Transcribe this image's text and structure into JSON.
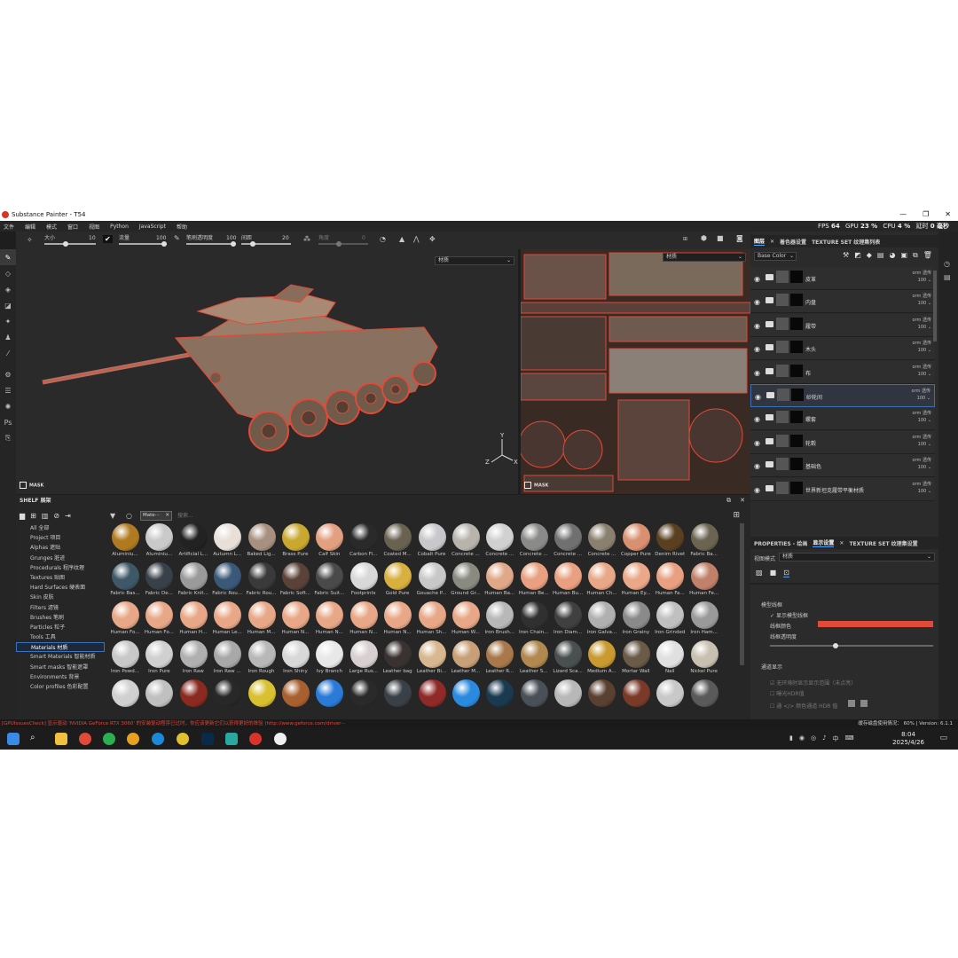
{
  "window": {
    "title": "Substance Painter - T54",
    "min": "—",
    "max": "❐",
    "close": "✕"
  },
  "menu": [
    "文件",
    "编辑",
    "模式",
    "窗口",
    "视图",
    "Python",
    "JavaScript",
    "帮助"
  ],
  "perf": {
    "fps_label": "FPS",
    "fps": "64",
    "gpu_label": "GPU",
    "gpu": "23 %",
    "cpu_label": "CPU",
    "cpu": "4 %",
    "delay_label": "延时",
    "delay": "0 毫秒"
  },
  "tool_options": {
    "size_label": "大小",
    "size": "10",
    "size_level": 0.4,
    "flow_label": "流量",
    "flow": "100",
    "flow_level": 1.0,
    "opacity_label": "笔刷透明度",
    "opacity": "100",
    "opacity_level": 1.0,
    "spacing_label": "间距",
    "spacing": "20",
    "spacing_level": 0.2,
    "angle_label": "角度",
    "angle": "0"
  },
  "viewport3d": {
    "mode_select": "材质",
    "mask_label": "MASK"
  },
  "viewport2d": {
    "mode_select": "材质",
    "mask_label": "MASK"
  },
  "right_tabs": {
    "layers": "图层",
    "color_settings": "着色器设置",
    "texture_set": "TEXTURE SET 纹理集列表"
  },
  "channel_select": "Base Color",
  "layers": [
    {
      "name": "皮革",
      "blend": "orm 透传",
      "opacity": "100"
    },
    {
      "name": "内盘",
      "blend": "orm 透传",
      "opacity": "100"
    },
    {
      "name": "履带",
      "blend": "orm 透传",
      "opacity": "100"
    },
    {
      "name": "木头",
      "blend": "orm 透传",
      "opacity": "100"
    },
    {
      "name": "布",
      "blend": "orm 透传",
      "opacity": "100"
    },
    {
      "name": "砂轮间",
      "blend": "orm 透传",
      "opacity": "100"
    },
    {
      "name": "螺套",
      "blend": "orm 透传",
      "opacity": "100"
    },
    {
      "name": "轮毂",
      "blend": "orm 透传",
      "opacity": "100"
    },
    {
      "name": "基础色",
      "blend": "orm 透传",
      "opacity": "100"
    },
    {
      "name": "世界新坦克履带平衡材质",
      "blend": "orm 透传",
      "opacity": "100"
    }
  ],
  "props_tabs": {
    "properties": "PROPERTIES - 绘画",
    "display": "显示设置",
    "texture": "TEXTURE SET 纹理集设置"
  },
  "props": {
    "view_mode_label": "视图模式",
    "view_mode": "材质",
    "wire_header": "模型线框",
    "show_wire": "显示模型线框",
    "wire_color": "线框颜色",
    "wire_opacity": "线框透明度",
    "wire_opacity_level": 0.4,
    "display_header": "通道显示",
    "opt1": "无环境时显示显示范围（未点亮）",
    "opt2": "曝光HDR值",
    "opt3": "通 </> 颜色通道 HDR 值"
  },
  "shelf": {
    "title": "SHELF 展架",
    "filter_chip": "Mate···",
    "search_placeholder": "搜索...",
    "categories": [
      "All 全部",
      "Project 项目",
      "Alphas 遮贴",
      "Grunges 脏迹",
      "Procedurals 程序纹理",
      "Textures 贴图",
      "Hard Surfaces 硬表面",
      "Skin 皮肤",
      "Filters 滤镜",
      "Brushes 笔刷",
      "Particles 粒子",
      "Tools 工具",
      "Materials 材质",
      "Smart Materials 智能材质",
      "Smart masks 智能遮罩",
      "Environments 背景",
      "Color profiles 色彩配置"
    ],
    "selected_category": 12,
    "materials": [
      {
        "name": "Aluminiu...",
        "color": "#b07a20"
      },
      {
        "name": "Aluminiu...",
        "color": "#c9c9c9"
      },
      {
        "name": "Artificial L...",
        "color": "#222222"
      },
      {
        "name": "Autumn L...",
        "color": "#e8e0d8"
      },
      {
        "name": "Baked Lig...",
        "color": "#a89080"
      },
      {
        "name": "Brass Pure",
        "color": "#c9a830"
      },
      {
        "name": "Calf Skin",
        "color": "#e2a080"
      },
      {
        "name": "Carbon Fi...",
        "color": "#2a2a2a"
      },
      {
        "name": "Coated M...",
        "color": "#6a6250"
      },
      {
        "name": "Cobalt Pure",
        "color": "#c8c8cc"
      },
      {
        "name": "Concrete ...",
        "color": "#b8b4ac"
      },
      {
        "name": "Concrete ...",
        "color": "#d0d0d0"
      },
      {
        "name": "Concrete ...",
        "color": "#8a8a88"
      },
      {
        "name": "Concrete ...",
        "color": "#707070"
      },
      {
        "name": "Concrete ...",
        "color": "#8a8070"
      },
      {
        "name": "Copper Pure",
        "color": "#d89070"
      },
      {
        "name": "Denim Rivet",
        "color": "#5a4020"
      },
      {
        "name": "Fabric Ba...",
        "color": "#6a6450"
      },
      {
        "name": "Fabric Bas...",
        "color": "#3e5868"
      },
      {
        "name": "Fabric De...",
        "color": "#38404a"
      },
      {
        "name": "Fabric Knit...",
        "color": "#9a9a9a"
      },
      {
        "name": "Fabric Rou...",
        "color": "#3a5878"
      },
      {
        "name": "Fabric Rou...",
        "color": "#3a3a3a"
      },
      {
        "name": "Fabric Soft...",
        "color": "#5a4238"
      },
      {
        "name": "Fabric Suit...",
        "color": "#4a4a4a"
      },
      {
        "name": "Footprints",
        "color": "#d8d8d8"
      },
      {
        "name": "Gold Pure",
        "color": "#d8b040"
      },
      {
        "name": "Gouache P...",
        "color": "#c8c8c8"
      },
      {
        "name": "Ground Gr...",
        "color": "#8a8a80"
      },
      {
        "name": "Human Ba...",
        "color": "#e0a888"
      },
      {
        "name": "Human Be...",
        "color": "#e8a080"
      },
      {
        "name": "Human Bu...",
        "color": "#e8a080"
      },
      {
        "name": "Human Ch...",
        "color": "#e8a888"
      },
      {
        "name": "Human Ey...",
        "color": "#eaa888"
      },
      {
        "name": "Human Fa...",
        "color": "#e8a080"
      },
      {
        "name": "Human Fe...",
        "color": "#c0806a"
      },
      {
        "name": "Human Fo...",
        "color": "#e8a888"
      },
      {
        "name": "Human Fo...",
        "color": "#e8a888"
      },
      {
        "name": "Human H...",
        "color": "#e8a888"
      },
      {
        "name": "Human Le...",
        "color": "#e8a888"
      },
      {
        "name": "Human M...",
        "color": "#e8a888"
      },
      {
        "name": "Human N...",
        "color": "#e8a888"
      },
      {
        "name": "Human N...",
        "color": "#e8a888"
      },
      {
        "name": "Human N...",
        "color": "#e8a888"
      },
      {
        "name": "Human N...",
        "color": "#e8a888"
      },
      {
        "name": "Human Sh...",
        "color": "#e8a888"
      },
      {
        "name": "Human W...",
        "color": "#e8a888"
      },
      {
        "name": "Iron Brush...",
        "color": "#b8b8b8"
      },
      {
        "name": "Iron Chain...",
        "color": "#303030"
      },
      {
        "name": "Iron Diam...",
        "color": "#404040"
      },
      {
        "name": "Iron Galva...",
        "color": "#b0b0b0"
      },
      {
        "name": "Iron Grainy",
        "color": "#8a8a8a"
      },
      {
        "name": "Iron Grinded",
        "color": "#c0c0c0"
      },
      {
        "name": "Iron Ham...",
        "color": "#9a9a9a"
      },
      {
        "name": "Iron Powd...",
        "color": "#c8c8c8"
      },
      {
        "name": "Iron Pure",
        "color": "#d0d0d0"
      },
      {
        "name": "Iron Raw",
        "color": "#b0b0b0"
      },
      {
        "name": "Iron Raw ...",
        "color": "#a8a8a8"
      },
      {
        "name": "Iron Rough",
        "color": "#b8b8b8"
      },
      {
        "name": "Iron Shiny",
        "color": "#d8d8d8"
      },
      {
        "name": "Ivy Branch",
        "color": "#e8e8e8"
      },
      {
        "name": "Large Rus...",
        "color": "#d8d0d0"
      },
      {
        "name": "Leather bag",
        "color": "#3a3230"
      },
      {
        "name": "Leather Bi...",
        "color": "#d8b890"
      },
      {
        "name": "Leather M...",
        "color": "#c8a078"
      },
      {
        "name": "Leather R...",
        "color": "#a8784a"
      },
      {
        "name": "Leather S...",
        "color": "#b08850"
      },
      {
        "name": "Lizard Sca...",
        "color": "#4a5050"
      },
      {
        "name": "Medium A...",
        "color": "#c89a30"
      },
      {
        "name": "Mortar Wall",
        "color": "#6a5a48"
      },
      {
        "name": "Nail",
        "color": "#e0e0e0"
      },
      {
        "name": "Nickel Pure",
        "color": "#c8c0b0"
      },
      {
        "name": "",
        "color": "#d0d0d0"
      },
      {
        "name": "",
        "color": "#c0c0c0"
      },
      {
        "name": "",
        "color": "#8a2a20"
      },
      {
        "name": "",
        "color": "#282828"
      },
      {
        "name": "",
        "color": "#d8c030"
      },
      {
        "name": "",
        "color": "#a86030"
      },
      {
        "name": "",
        "color": "#2a7ad8"
      },
      {
        "name": "",
        "color": "#2a2a2a"
      },
      {
        "name": "",
        "color": "#3a4048"
      },
      {
        "name": "",
        "color": "#902a28"
      },
      {
        "name": "",
        "color": "#2a8ae0"
      },
      {
        "name": "",
        "color": "#1a3a50"
      },
      {
        "name": "",
        "color": "#4a5058"
      },
      {
        "name": "",
        "color": "#b8b8b8"
      },
      {
        "name": "",
        "color": "#5a4030"
      },
      {
        "name": "",
        "color": "#7a3a28"
      },
      {
        "name": "",
        "color": "#c8c8c8"
      },
      {
        "name": "",
        "color": "#5a5a5a"
      }
    ]
  },
  "status": {
    "warning": "[GPUIssuesCheck] 显示驱动 'NVIDIA GeForce RTX 3060' 的安装驱动程序已过时，你应该更新它们以获得更好的体验 (http://www.geforce.com/driver···",
    "cache_label": "缓存磁盘使用情况：",
    "cache": "60%",
    "version": "Version: 6.1.1"
  },
  "taskbar": {
    "time": "8:04",
    "date": "2025/4/26",
    "ime": "中"
  },
  "colors": {
    "accent": "#4aa3ff",
    "wire": "#e04a38",
    "warning": "#e0473a"
  }
}
